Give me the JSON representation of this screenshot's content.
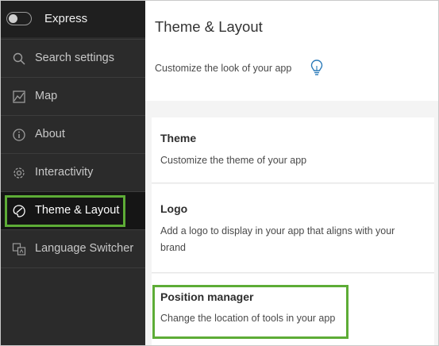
{
  "sidebar": {
    "toggle_label": "Express",
    "items": [
      {
        "label": "Search settings",
        "icon": "search-icon"
      },
      {
        "label": "Map",
        "icon": "map-icon"
      },
      {
        "label": "About",
        "icon": "info-icon"
      },
      {
        "label": "Interactivity",
        "icon": "gear-icon"
      },
      {
        "label": "Theme & Layout",
        "icon": "palette-icon"
      },
      {
        "label": "Language Switcher",
        "icon": "language-icon"
      }
    ]
  },
  "main": {
    "title": "Theme & Layout",
    "subtitle": "Customize the look of your app",
    "cards": [
      {
        "title": "Theme",
        "description": "Customize the theme of your app"
      },
      {
        "title": "Logo",
        "description": "Add a logo to display in your app that aligns with your brand"
      },
      {
        "title": "Position manager",
        "description": "Change the location of tools in your app"
      }
    ]
  },
  "colors": {
    "sidebar_bg": "#2b2b2b",
    "highlight": "#5dac36",
    "bulb": "#2a7ab8"
  }
}
